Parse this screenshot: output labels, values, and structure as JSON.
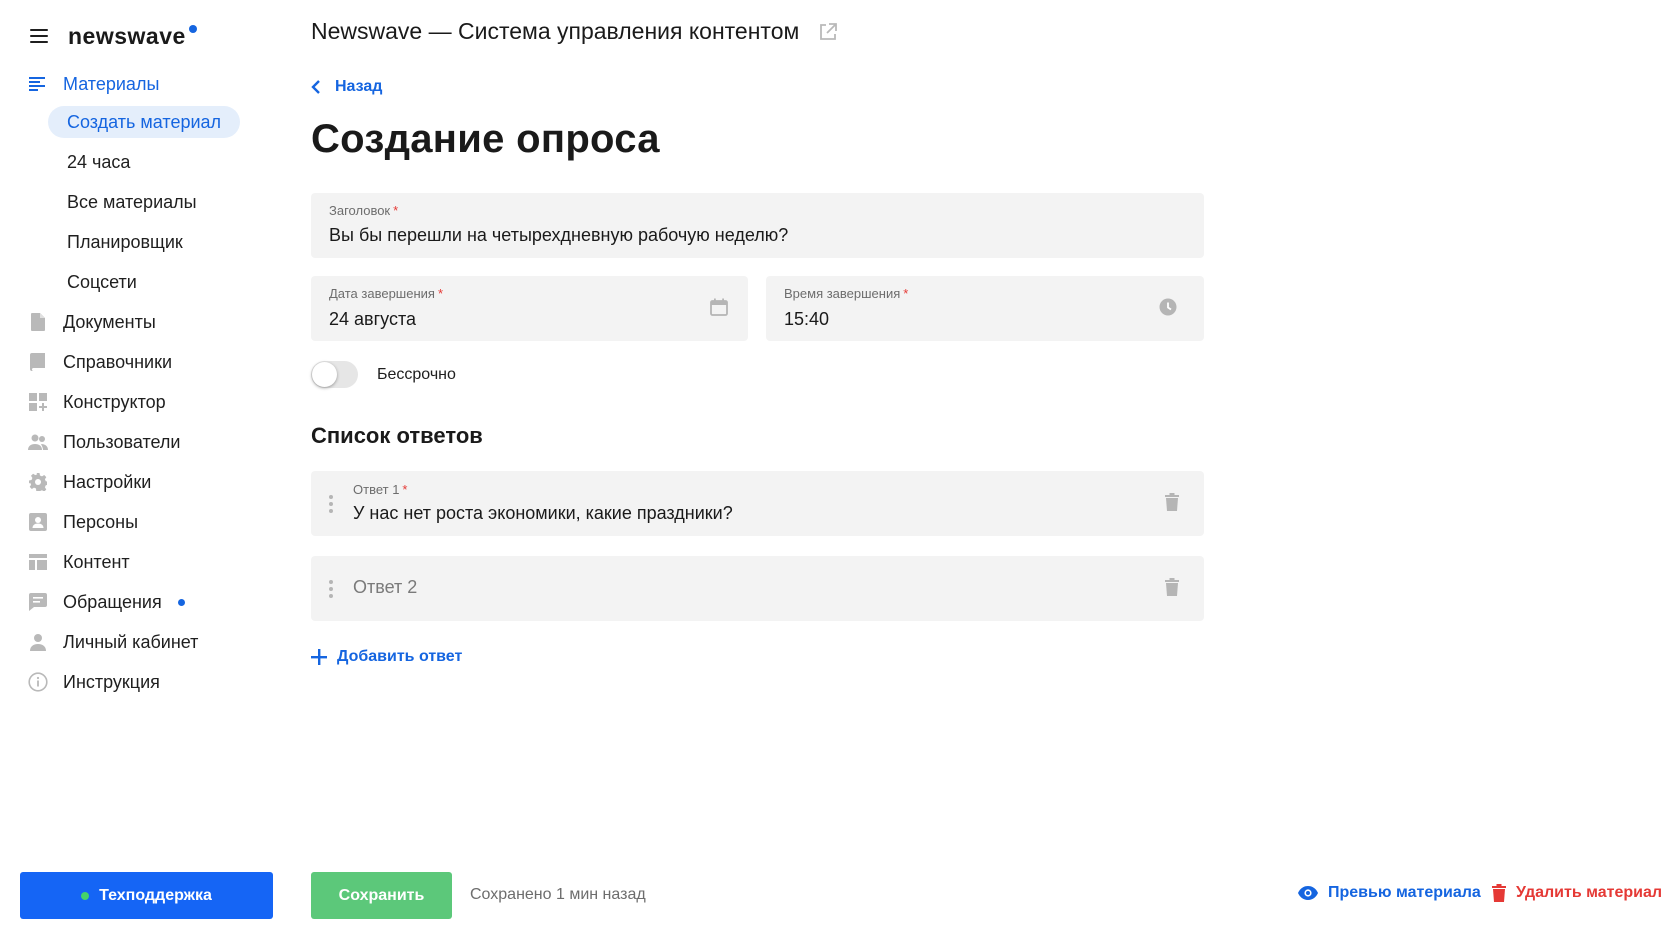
{
  "brand": {
    "name": "newswave"
  },
  "sidebar": {
    "items": [
      {
        "label": "Материалы",
        "icon": "materials-icon",
        "active": true
      },
      {
        "label": "Документы",
        "icon": "document-icon"
      },
      {
        "label": "Справочники",
        "icon": "book-icon"
      },
      {
        "label": "Конструктор",
        "icon": "constructor-icon"
      },
      {
        "label": "Пользователи",
        "icon": "users-icon"
      },
      {
        "label": "Настройки",
        "icon": "gear-icon"
      },
      {
        "label": "Персоны",
        "icon": "person-card-icon"
      },
      {
        "label": "Контент",
        "icon": "content-layout-icon"
      },
      {
        "label": "Обращения",
        "icon": "chat-icon",
        "has_notification": true
      },
      {
        "label": "Личный кабинет",
        "icon": "user-icon"
      },
      {
        "label": "Инструкция",
        "icon": "info-icon"
      }
    ],
    "subitems": [
      {
        "label": "Создать материал",
        "selected": true
      },
      {
        "label": "24 часа"
      },
      {
        "label": "Все материалы"
      },
      {
        "label": "Планировщик"
      },
      {
        "label": "Соцсети"
      }
    ],
    "support_button": "Техподдержка"
  },
  "header": {
    "title": "Newswave — Система управления контентом"
  },
  "page": {
    "back_label": "Назад",
    "title": "Создание опроса"
  },
  "form": {
    "headline": {
      "label": "Заголовок",
      "value": "Вы бы перешли на четырехдневную рабочую неделю?"
    },
    "end_date": {
      "label": "Дата завершения",
      "value": "24 августа"
    },
    "end_time": {
      "label": "Время завершения",
      "value": "15:40"
    },
    "unlimited": {
      "label": "Бессрочно",
      "checked": false
    },
    "answers_title": "Список ответов",
    "answers": [
      {
        "label": "Ответ 1",
        "value": "У нас нет роста экономики, какие праздники?"
      },
      {
        "placeholder": "Ответ 2"
      }
    ],
    "add_answer": "Добавить ответ"
  },
  "footer": {
    "save_label": "Сохранить",
    "saved_status": "Сохранено 1 мин назад",
    "preview_label": "Превью материала",
    "delete_label": "Удалить материал"
  },
  "colors": {
    "accent": "#1565e0",
    "save": "#5cc87a",
    "danger": "#e53935",
    "support": "#1565f5"
  }
}
